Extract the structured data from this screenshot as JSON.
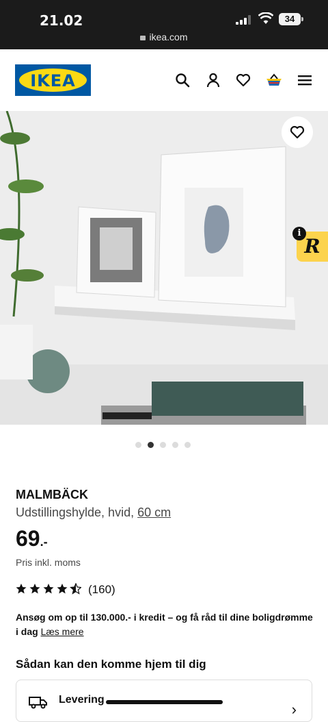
{
  "status_bar": {
    "time": "21.02",
    "battery": "34",
    "url": "ikea.com"
  },
  "header": {
    "logo_text": "IKEA",
    "icons": [
      "search-icon",
      "account-icon",
      "favourite-icon",
      "basket-icon",
      "menu-icon"
    ]
  },
  "gallery": {
    "image_count": 5,
    "active_index": 2
  },
  "product": {
    "name": "MALMBÄCK",
    "description": "Udstillingshylde, hvid, ",
    "size": "60 cm",
    "price": "69",
    "price_suffix": ".-",
    "price_note": "Pris inkl. moms",
    "rating": 4.5,
    "review_count": "(160)"
  },
  "credit": {
    "text": "Ansøg om op til 130.000.- i kredit – og få råd til dine boligdrømme i dag ",
    "link": "Læs mere"
  },
  "delivery": {
    "heading": "Sådan kan den komme hjem til dig",
    "option_label": "Levering"
  },
  "colors": {
    "ikea_blue": "#0058a3",
    "ikea_yellow": "#fbd914",
    "plugin_yellow": "#fcd34d"
  }
}
